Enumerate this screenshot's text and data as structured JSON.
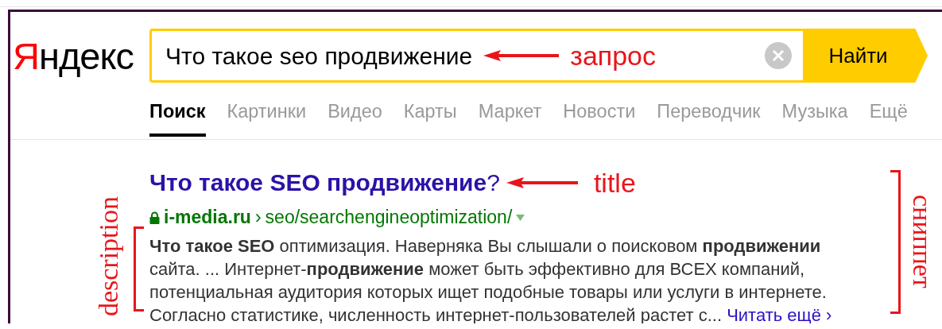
{
  "logo": {
    "first_letter": "Я",
    "rest": "ндекс"
  },
  "search": {
    "value": "Что такое seo продвижение",
    "button": "Найти"
  },
  "tabs": [
    {
      "label": "Поиск",
      "selected": true
    },
    {
      "label": "Картинки",
      "selected": false
    },
    {
      "label": "Видео",
      "selected": false
    },
    {
      "label": "Карты",
      "selected": false
    },
    {
      "label": "Маркет",
      "selected": false
    },
    {
      "label": "Новости",
      "selected": false
    },
    {
      "label": "Переводчик",
      "selected": false
    },
    {
      "label": "Музыка",
      "selected": false
    },
    {
      "label": "Ещё",
      "selected": false
    }
  ],
  "result": {
    "title": "**Что такое SEO продвижение**?",
    "secure": true,
    "domain": "i-media.ru",
    "separator": "›",
    "path": "seo/searchengineoptimization/",
    "snippet": "**Что такое SEO** оптимизация. Наверняка Вы слышали о поисковом **продвижении** сайта. ... Интернет-**продвижение** может быть эффективно для ВСЕХ компаний, потенциальная аудитория которых ищет подобные товары или услуги в интернете. Согласно статистике, численность интернет-пользователей растет с...",
    "read_more": "Читать ещё ›"
  },
  "annotations": [
    {
      "kind": "arrow",
      "label": "запрос"
    },
    {
      "kind": "arrow",
      "label": "title"
    },
    {
      "kind": "bracket",
      "label": "description"
    },
    {
      "kind": "bracket",
      "label": "сниппет"
    }
  ]
}
